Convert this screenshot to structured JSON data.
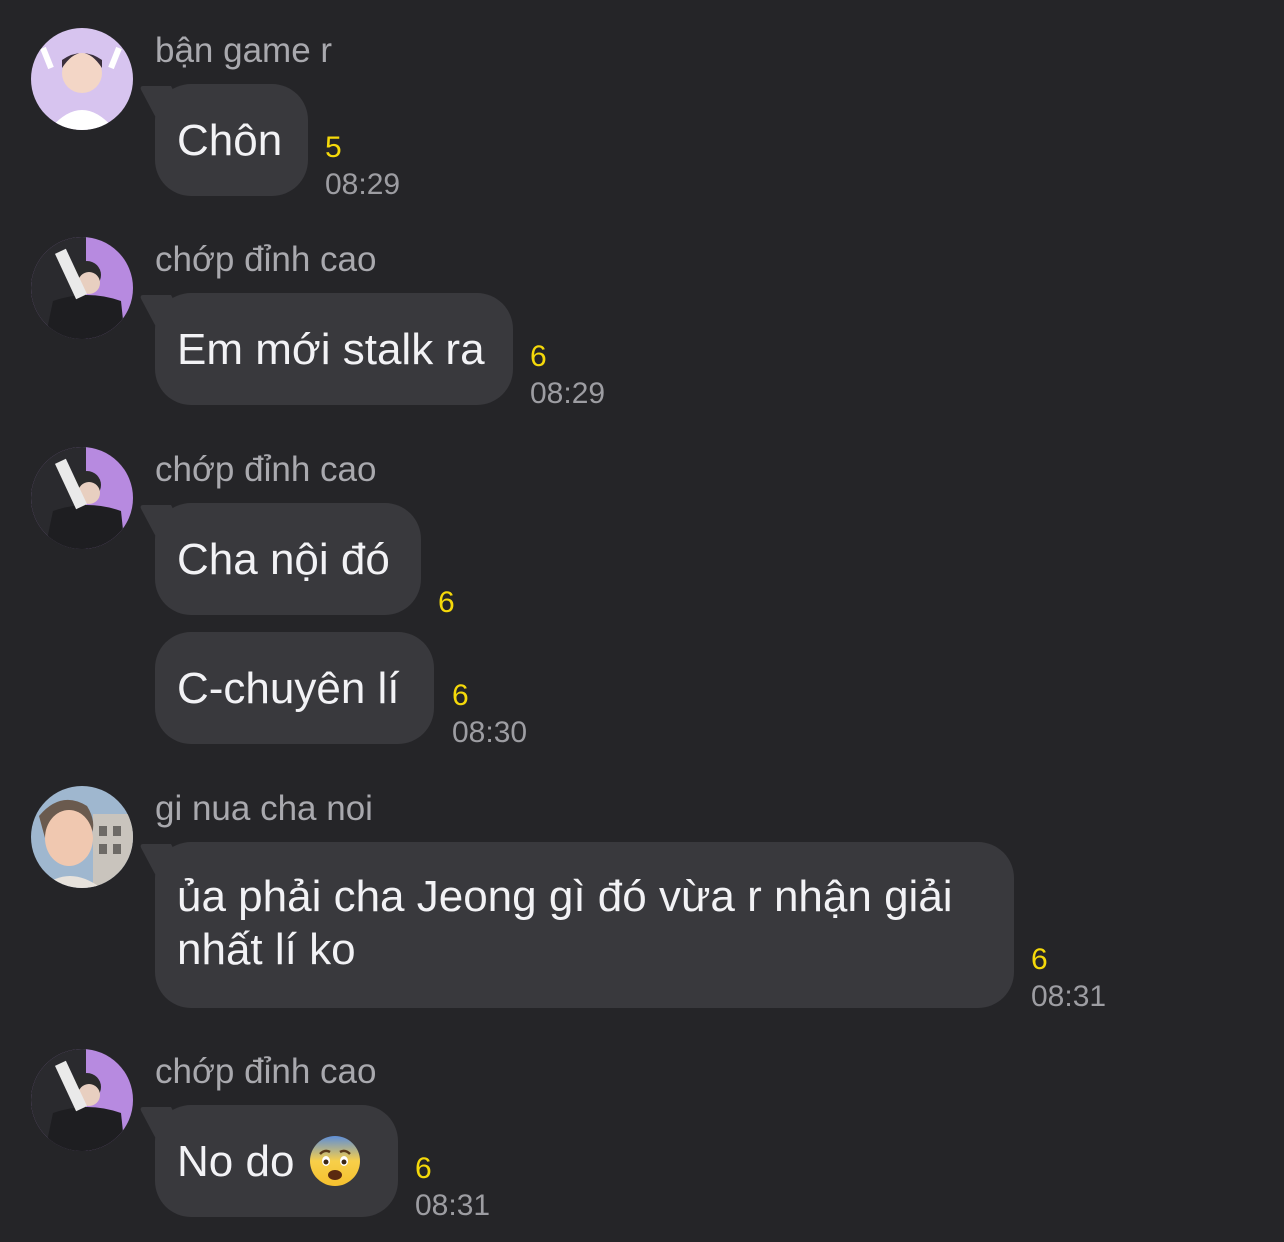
{
  "colors": {
    "background": "#252528",
    "bubble": "#39393d",
    "count": "#f5d90a",
    "time": "#9d9da2",
    "sender": "#a9a9ae"
  },
  "messages": [
    {
      "sender": "bận game r",
      "avatar": "avatar-purple-icon",
      "bubbles": [
        {
          "text": "Chôn",
          "count": "5",
          "time": "08:29"
        }
      ]
    },
    {
      "sender": "chớp đỉnh cao",
      "avatar": "avatar-purple-icon",
      "bubbles": [
        {
          "text": "Em mới stalk ra",
          "count": "6",
          "time": "08:29"
        }
      ]
    },
    {
      "sender": "chớp đỉnh cao",
      "avatar": "avatar-purple-icon",
      "bubbles": [
        {
          "text": "Cha nội đó",
          "count": "6",
          "time": ""
        },
        {
          "text": "C-chuyên lí",
          "count": "6",
          "time": "08:30"
        }
      ]
    },
    {
      "sender": "gi nua cha noi",
      "avatar": "avatar-blue-icon",
      "bubbles": [
        {
          "text": "ủa phải cha Jeong gì đó vừa r nhận giải nhất lí ko",
          "count": "6",
          "time": "08:31"
        }
      ]
    },
    {
      "sender": "chớp đỉnh cao",
      "avatar": "avatar-purple-icon",
      "bubbles": [
        {
          "text": "No do",
          "emoji": "fearful-face-emoji-icon",
          "count": "6",
          "time": "08:31"
        }
      ]
    }
  ]
}
